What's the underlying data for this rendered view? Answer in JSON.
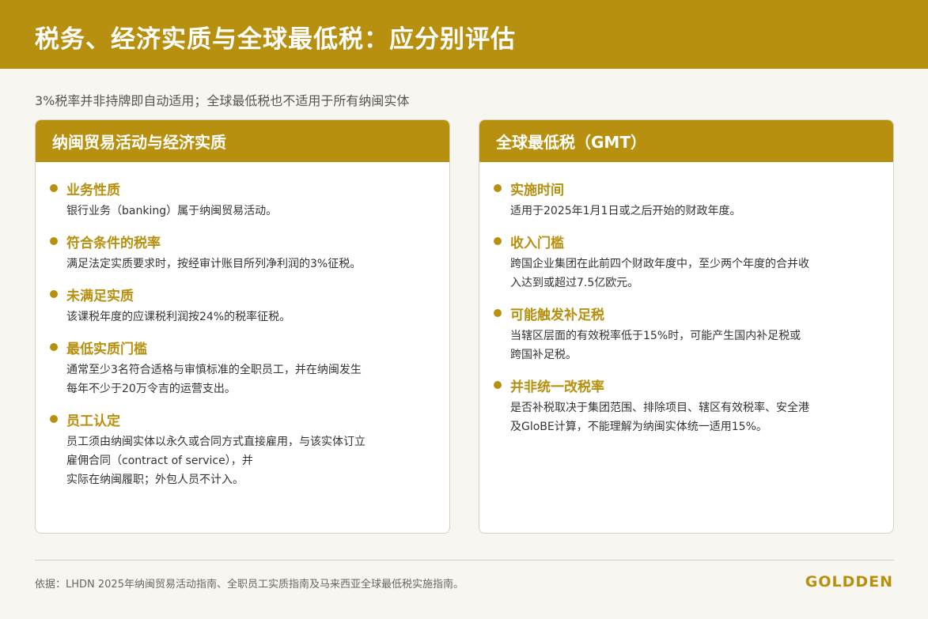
{
  "header": {
    "title": "税务、经济实质与全球最低税：应分别评估"
  },
  "subtitle": "3%税率并非持牌即自动适用；全球最低税也不适用于所有纳闽实体",
  "left_card": {
    "title": "纳闽贸易活动与经济实质",
    "items": [
      {
        "title": "业务性质",
        "body": "银行业务（banking）属于纳闽贸易活动。"
      },
      {
        "title": "符合条件的税率",
        "body": "满足法定实质要求时，按经审计账目所列净利润的3%征税。"
      },
      {
        "title": "未满足实质",
        "body": "该课税年度的应课税利润按24%的税率征税。"
      },
      {
        "title": "最低实质门槛",
        "body": "通常至少3名符合适格与审慎标准的全职员工，并在纳闽发生\n每年不少于20万令吉的运营支出。"
      },
      {
        "title": "员工认定",
        "body": "员工须由纳闽实体以永久或合同方式直接雇用，与该实体订立\n雇佣合同（contract of service），并\n实际在纳闽履职；外包人员不计入。"
      }
    ]
  },
  "right_card": {
    "title": "全球最低税（GMT）",
    "items": [
      {
        "title": "实施时间",
        "body": "适用于2025年1月1日或之后开始的财政年度。"
      },
      {
        "title": "收入门槛",
        "body": "跨国企业集团在此前四个财政年度中，至少两个年度的合并收\n入达到或超过7.5亿欧元。"
      },
      {
        "title": "可能触发补足税",
        "body": "当辖区层面的有效税率低于15%时，可能产生国内补足税或\n跨国补足税。"
      },
      {
        "title": "并非统一改税率",
        "body": "是否补税取决于集团范围、排除项目、辖区有效税率、安全港\n及GloBE计算，不能理解为纳闽实体统一适用15%。"
      }
    ]
  },
  "footer": {
    "note": "依据：LHDN 2025年纳闽贸易活动指南、全职员工实质指南及马来西亚全球最低税实施指南。",
    "brand": "GOLDDEN"
  },
  "colors": {
    "accent": "#b8900f",
    "background": "#f8f6f1"
  }
}
